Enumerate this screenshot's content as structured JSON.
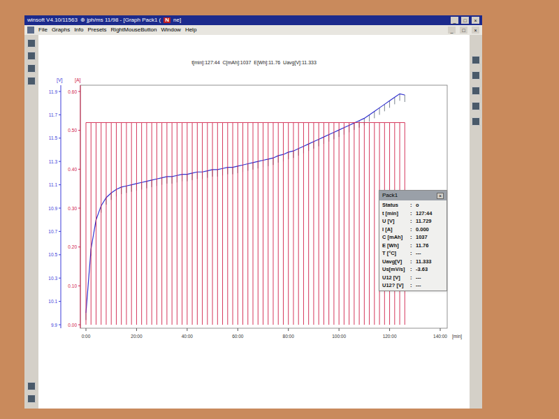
{
  "window": {
    "title_parts": [
      "winsoft V4.10/11563",
      "⊕ jph/ms 11/98 - [Graph Pack1 (",
      "ne]"
    ],
    "badge": "N",
    "controls": [
      "_",
      "□",
      "×"
    ]
  },
  "menu": {
    "items": [
      "File",
      "Graphs",
      "Info",
      "Presets",
      "RightMouseButton",
      "Window",
      "Help"
    ],
    "controls": [
      "_",
      "□",
      "×"
    ]
  },
  "chart": {
    "header": "t[min]:127:44  C[mAh]:1037  E[Wh]:11.76  Uavg[V]:11.333",
    "y_axes": [
      {
        "unit": "[V]",
        "color": "#3a3ad8",
        "min": 9.9,
        "max": 11.9,
        "ticks": [
          "11.9",
          "11.7",
          "11.5",
          "11.3",
          "11.1",
          "10.9",
          "10.7",
          "10.5",
          "10.3",
          "10.1",
          "9.9"
        ]
      },
      {
        "unit": "[A]",
        "color": "#d0204a",
        "min": 0,
        "max": 0.6,
        "ticks": [
          "0.60",
          "0.50",
          "0.40",
          "0.30",
          "0.20",
          "0.10",
          "0.00"
        ]
      }
    ],
    "x_axis": {
      "unit": "[min]",
      "min": 0,
      "max": 140,
      "ticks": [
        "0:00",
        "20:00",
        "40:00",
        "60:00",
        "80:00",
        "100:00",
        "120:00",
        "140:00"
      ]
    },
    "series": [
      {
        "name": "U",
        "axis": 0,
        "color": "#3030d0",
        "x_start": 0,
        "x_step": 2,
        "values": [
          10.0,
          10.55,
          10.8,
          10.92,
          10.99,
          11.03,
          11.06,
          11.08,
          11.09,
          11.1,
          11.11,
          11.12,
          11.13,
          11.14,
          11.15,
          11.16,
          11.17,
          11.17,
          11.18,
          11.19,
          11.19,
          11.2,
          11.21,
          11.21,
          11.22,
          11.23,
          11.23,
          11.24,
          11.25,
          11.25,
          11.26,
          11.27,
          11.28,
          11.29,
          11.3,
          11.31,
          11.32,
          11.33,
          11.35,
          11.36,
          11.38,
          11.39,
          11.41,
          11.43,
          11.45,
          11.47,
          11.49,
          11.51,
          11.53,
          11.55,
          11.57,
          11.59,
          11.61,
          11.63,
          11.65,
          11.67,
          11.7,
          11.73,
          11.76,
          11.79,
          11.82,
          11.85,
          11.88,
          11.87
        ]
      },
      {
        "name": "I",
        "axis": 1,
        "color": "#d0204a",
        "x_start": 0,
        "x_step": 2,
        "values": [
          0.52,
          0.52,
          0.52,
          0.52,
          0.52,
          0.52,
          0.52,
          0.52,
          0.52,
          0.52,
          0.52,
          0.52,
          0.52,
          0.52,
          0.52,
          0.52,
          0.52,
          0.52,
          0.52,
          0.52,
          0.52,
          0.52,
          0.52,
          0.52,
          0.52,
          0.52,
          0.52,
          0.52,
          0.52,
          0.52,
          0.52,
          0.52,
          0.52,
          0.52,
          0.52,
          0.52,
          0.52,
          0.52,
          0.52,
          0.52,
          0.52,
          0.52,
          0.52,
          0.52,
          0.52,
          0.52,
          0.52,
          0.52,
          0.52,
          0.52,
          0.52,
          0.52,
          0.52,
          0.52,
          0.52,
          0.52,
          0.52,
          0.52,
          0.52,
          0.52,
          0.52,
          0.52,
          0.52,
          0.52
        ]
      }
    ]
  },
  "panel": {
    "title": "Pack1",
    "close": "×",
    "separator": ":",
    "rows": [
      {
        "label": "Status",
        "value": "o"
      },
      {
        "label": "t [min]",
        "value": "127:44"
      },
      {
        "label": "U [V]",
        "value": "11.729"
      },
      {
        "label": "I [A]",
        "value": "0.000"
      },
      {
        "label": "C [mAh]",
        "value": "1037"
      },
      {
        "label": "E [Wh]",
        "value": "11.76"
      },
      {
        "label": "T [°C]",
        "value": "---"
      },
      {
        "label": "Uavg[V]",
        "value": "11.333"
      },
      {
        "label": "Us[mV/s]",
        "value": "-3.63"
      },
      {
        "label": "U12 [V]",
        "value": "---"
      },
      {
        "label": "U12? [V]",
        "value": "---"
      }
    ]
  }
}
